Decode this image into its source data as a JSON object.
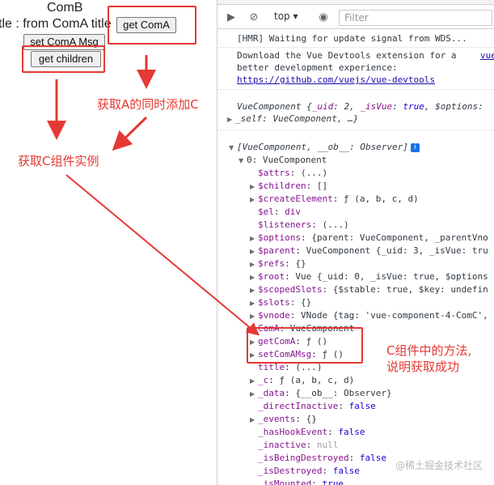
{
  "app": {
    "heading": "ComB",
    "title_line": "tle : from ComA title",
    "get_coma_label": "get ComA",
    "set_msg_label": "set ComA Msg",
    "get_children_label": "get children"
  },
  "annotations": {
    "add_c": "获取A的同时添加C",
    "get_c_instance": "获取C组件实例",
    "methods_note_1": "C组件中的方法,",
    "methods_note_2": "说明获取成功"
  },
  "devtools": {
    "context": "top",
    "filter_placeholder": "Filter",
    "lines": {
      "hmr": "[HMR] Waiting for update signal from WDS...",
      "dl1": "Download the Vue Devtools extension for a",
      "dl1_link": "vue",
      "dl2": "better development experience:",
      "dl3": "https://github.com/vuejs/vue-devtools",
      "vc1a": "VueComponent {",
      "vc1b": "_uid",
      "vc1c": ": 2, ",
      "vc1d": "_isVue",
      "vc1e": ": ",
      "vc1f": "true",
      "vc1g": ", $options: ",
      "vc2": "_self: VueComponent, …}",
      "arr": "[VueComponent, __ob__: Observer]",
      "item0": "0: VueComponent",
      "props": [
        {
          "k": "$attrs",
          "v": "(...)"
        },
        {
          "k": "$children",
          "v": "[]"
        },
        {
          "k": "$createElement",
          "v": "ƒ (a, b, c, d)"
        },
        {
          "k": "$el",
          "v": "div"
        },
        {
          "k": "$listeners",
          "v": "(...)"
        },
        {
          "k": "$options",
          "v": "{parent: VueComponent, _parentVno"
        },
        {
          "k": "$parent",
          "v": "VueComponent {_uid: 3, _isVue: tru"
        },
        {
          "k": "$refs",
          "v": "{}"
        },
        {
          "k": "$root",
          "v": "Vue {_uid: 0, _isVue: true, $options"
        },
        {
          "k": "$scopedSlots",
          "v": "{$stable: true, $key: undefin"
        },
        {
          "k": "$slots",
          "v": "{}"
        },
        {
          "k": "$vnode",
          "v": "VNode {tag: 'vue-component-4-ComC',"
        },
        {
          "k": "ComA",
          "v": "VueComponent"
        },
        {
          "k": "getComA",
          "v": "ƒ ()"
        },
        {
          "k": "setComAMsg",
          "v": "ƒ ()"
        },
        {
          "k": "title",
          "v": "(...)"
        },
        {
          "k": "_c",
          "v": "ƒ (a, b, c, d)"
        },
        {
          "k": "_data",
          "v": "{__ob__: Observer}"
        },
        {
          "k": "_directInactive",
          "v": "false"
        },
        {
          "k": "_events",
          "v": "{}"
        },
        {
          "k": "_hasHookEvent",
          "v": "false"
        },
        {
          "k": "_inactive",
          "v": "null"
        },
        {
          "k": "_isBeingDestroyed",
          "v": "false"
        },
        {
          "k": "_isDestroyed",
          "v": "false"
        },
        {
          "k": "_isMounted",
          "v": "true"
        }
      ]
    }
  },
  "watermark": "@稀土掘金技术社区",
  "colors": {
    "annotation_red": "#e53935",
    "devtools_key": "#881391",
    "link_blue": "#1a0dab"
  }
}
